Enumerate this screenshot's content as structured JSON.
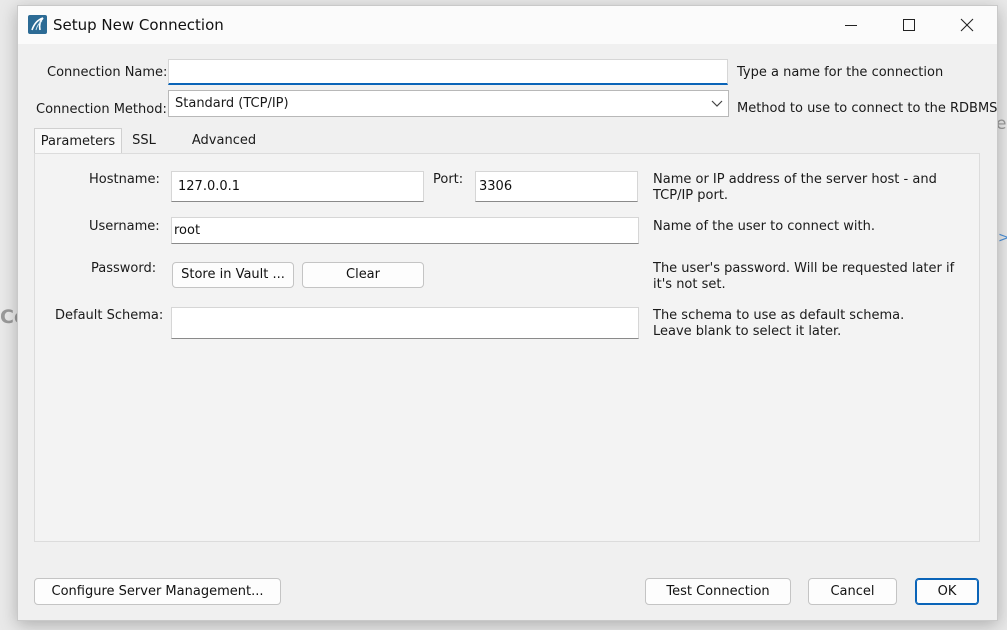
{
  "window": {
    "title": "Setup New Connection"
  },
  "connection": {
    "name_label": "Connection Name:",
    "name_value": "",
    "name_hint": "Type a name for the connection",
    "method_label": "Connection Method:",
    "method_value": "Standard (TCP/IP)",
    "method_hint": "Method to use to connect to the RDBMS"
  },
  "tabs": [
    {
      "label": "Parameters",
      "active": true
    },
    {
      "label": "SSL",
      "active": false
    },
    {
      "label": "Advanced",
      "active": false
    }
  ],
  "parameters": {
    "hostname_label": "Hostname:",
    "hostname_value": "127.0.0.1",
    "port_label": "Port:",
    "port_value": "3306",
    "hostname_hint": "Name or IP address of the server host - and TCP/IP port.",
    "username_label": "Username:",
    "username_value": "root",
    "username_hint": "Name of the user to connect with.",
    "password_label": "Password:",
    "store_vault_label": "Store in Vault ...",
    "clear_label": "Clear",
    "password_hint": "The user's password. Will be requested later if it's not set.",
    "schema_label": "Default Schema:",
    "schema_value": "",
    "schema_hint": "The schema to use as default schema. Leave blank to select it later."
  },
  "footer": {
    "configure_label": "Configure Server Management...",
    "test_label": "Test Connection",
    "cancel_label": "Cancel",
    "ok_label": "OK"
  },
  "background": {
    "left_fragment": "Co",
    "right_fragment": "er",
    "right_arrow": ">"
  },
  "icons": [
    "mysql-workbench-icon",
    "minimize-icon",
    "maximize-icon",
    "close-icon",
    "chevron-down-icon"
  ],
  "colors": {
    "accent": "#0a64b8",
    "app_icon": "#2c6b95"
  }
}
